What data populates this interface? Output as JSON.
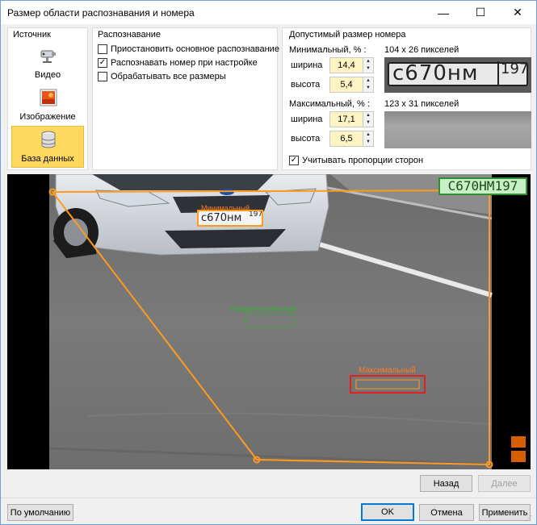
{
  "window": {
    "title": "Размер области распознавания и номера",
    "minimize": "—",
    "maximize": "☐",
    "close": "✕"
  },
  "source": {
    "title": "Источник",
    "items": [
      {
        "label": "Видео",
        "icon": "camera-icon"
      },
      {
        "label": "Изображение",
        "icon": "image-icon"
      },
      {
        "label": "База данных",
        "icon": "database-icon",
        "active": true
      }
    ]
  },
  "recognition": {
    "title": "Распознавание",
    "options": [
      {
        "label": "Приостановить основное распознавание",
        "checked": false
      },
      {
        "label": "Распознавать номер при настройке",
        "checked": true
      },
      {
        "label": "Обрабатывать все размеры",
        "checked": false
      }
    ]
  },
  "plate_size": {
    "title": "Допустимый размер номера",
    "min_label": "Минимальный, % :",
    "min_preview_label": "104 x 26 пикселей",
    "min_width_label": "ширина",
    "min_width": "14,4",
    "min_height_label": "высота",
    "min_height": "5,4",
    "max_label": "Максимальный, % :",
    "max_preview_label": "123 x 31 пикселей",
    "max_width_label": "ширина",
    "max_width": "17,1",
    "max_height_label": "высота",
    "max_height": "6,5",
    "plate_text": "с670нм",
    "plate_region": "197",
    "keep_ratio_label": "Учитывать пропорции сторон",
    "keep_ratio_checked": true
  },
  "video": {
    "recognized_plate": "C670HM197",
    "car_plate": "с670нм",
    "car_plate_region": "197",
    "car_plate_tag": "Минимальный",
    "preferred_label": "Предпочтительный",
    "max_label": "Максимальный"
  },
  "buttons": {
    "back": "Назад",
    "next": "Далее",
    "default": "По умолчанию",
    "ok": "OK",
    "cancel": "Отмена",
    "apply": "Применить"
  },
  "colors": {
    "accent": "#ffd95e",
    "zone": "#ff9a1f",
    "preferred": "#2fb52f",
    "max_box": "#e02020",
    "plate_badge_bg": "#c7f0c7"
  }
}
